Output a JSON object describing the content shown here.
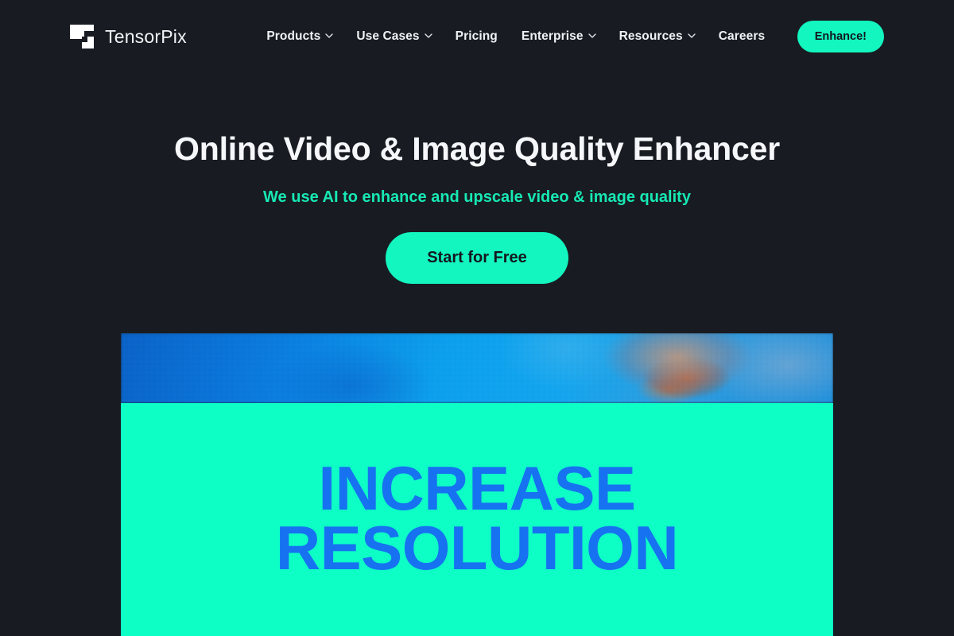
{
  "theme": {
    "background": "#181c22",
    "accent_green": "#13f6c0",
    "panel_green": "#0dffc6",
    "caption_blue": "#1672f0",
    "text_light": "#f2f4f7",
    "subtitle_green": "#17e8b4"
  },
  "header": {
    "brand_name": "TensorPix",
    "brand_mark_icon": "tensorpix-logo-icon",
    "nav": [
      {
        "label": "Products",
        "has_dropdown": true,
        "icon": "chevron-down-icon"
      },
      {
        "label": "Use Cases",
        "has_dropdown": true,
        "icon": "chevron-down-icon"
      },
      {
        "label": "Pricing",
        "has_dropdown": false,
        "icon": ""
      },
      {
        "label": "Enterprise",
        "has_dropdown": true,
        "icon": "chevron-down-icon"
      },
      {
        "label": "Resources",
        "has_dropdown": true,
        "icon": "chevron-down-icon"
      },
      {
        "label": "Careers",
        "has_dropdown": false,
        "icon": ""
      }
    ],
    "cta_label": "Enhance!"
  },
  "hero": {
    "title": "Online Video & Image Quality Enhancer",
    "subtitle": "We use AI to enhance and upscale video & image quality",
    "cta_label": "Start for Free"
  },
  "showcase": {
    "top_image_description": "pixelated low-resolution blue underwater photo",
    "caption_line_1": "INCREASE",
    "caption_line_2": "RESOLUTION"
  }
}
